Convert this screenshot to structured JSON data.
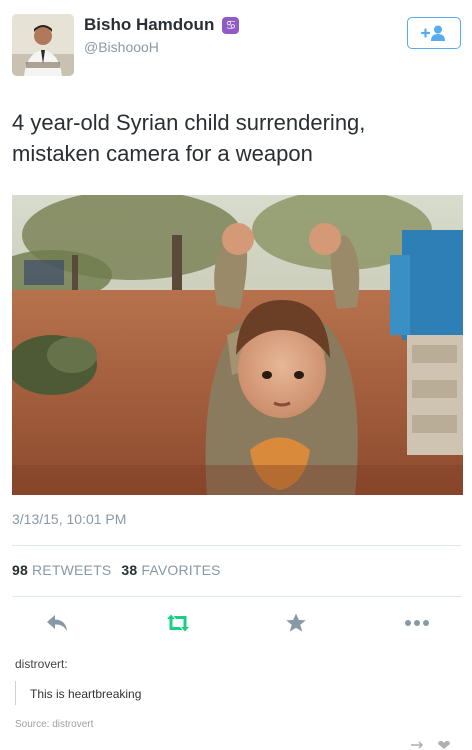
{
  "tweet": {
    "display_name": "Bisho Hamdoun",
    "zodiac_badge": "♋",
    "handle": "@BishoooH",
    "follow_label": "+",
    "text": "4 year-old Syrian child surrendering, mistaken camera for a weapon",
    "timestamp": "3/13/15, 10:01 PM",
    "retweets_count": "98",
    "retweets_label": "RETWEETS",
    "favorites_count": "38",
    "favorites_label": "FAVORITES"
  },
  "icons": {
    "reply": "reply-icon",
    "retweet": "retweet-icon",
    "favorite": "star-icon",
    "more": "more-icon",
    "follow": "add-user-icon",
    "zodiac": "cancer-zodiac-icon"
  },
  "colors": {
    "twitter_blue": "#55acee",
    "retweet_green": "#19cf86",
    "muted_gray": "#8899a6",
    "icon_gray": "#8899a6",
    "zodiac_purple": "#8e5cc4"
  },
  "repost": {
    "author": "distrovert:",
    "comment": "This is heartbreaking",
    "source_label": "Source:",
    "source_name": "distrovert"
  }
}
